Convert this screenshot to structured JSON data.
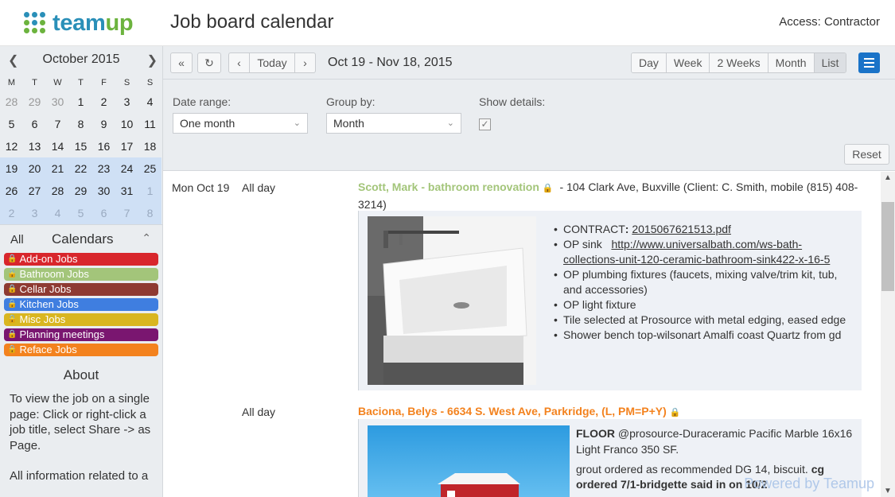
{
  "header": {
    "logo_text": "team",
    "logo_text_accent": "up",
    "title": "Job board calendar",
    "access": "Access: Contractor"
  },
  "mini_calendar": {
    "month": "October 2015",
    "prev_icon": "chevron-left-icon",
    "next_icon": "chevron-right-icon",
    "dow": [
      "M",
      "T",
      "W",
      "T",
      "F",
      "S",
      "S"
    ],
    "days": [
      {
        "d": "28",
        "other": true,
        "range": false
      },
      {
        "d": "29",
        "other": true,
        "range": false
      },
      {
        "d": "30",
        "other": true,
        "range": false
      },
      {
        "d": "1",
        "other": false,
        "range": false
      },
      {
        "d": "2",
        "other": false,
        "range": false
      },
      {
        "d": "3",
        "other": false,
        "range": false
      },
      {
        "d": "4",
        "other": false,
        "range": false
      },
      {
        "d": "5",
        "other": false,
        "range": false
      },
      {
        "d": "6",
        "other": false,
        "range": false
      },
      {
        "d": "7",
        "other": false,
        "range": false
      },
      {
        "d": "8",
        "other": false,
        "range": false
      },
      {
        "d": "9",
        "other": false,
        "range": false
      },
      {
        "d": "10",
        "other": false,
        "range": false
      },
      {
        "d": "11",
        "other": false,
        "range": false
      },
      {
        "d": "12",
        "other": false,
        "range": false
      },
      {
        "d": "13",
        "other": false,
        "range": false
      },
      {
        "d": "14",
        "other": false,
        "range": false
      },
      {
        "d": "15",
        "other": false,
        "range": false
      },
      {
        "d": "16",
        "other": false,
        "range": false
      },
      {
        "d": "17",
        "other": false,
        "range": false
      },
      {
        "d": "18",
        "other": false,
        "range": false
      },
      {
        "d": "19",
        "other": false,
        "range": true
      },
      {
        "d": "20",
        "other": false,
        "range": true
      },
      {
        "d": "21",
        "other": false,
        "range": true
      },
      {
        "d": "22",
        "other": false,
        "range": true
      },
      {
        "d": "23",
        "other": false,
        "range": true
      },
      {
        "d": "24",
        "other": false,
        "range": true
      },
      {
        "d": "25",
        "other": false,
        "range": true
      },
      {
        "d": "26",
        "other": false,
        "range": true
      },
      {
        "d": "27",
        "other": false,
        "range": true
      },
      {
        "d": "28",
        "other": false,
        "range": true
      },
      {
        "d": "29",
        "other": false,
        "range": true
      },
      {
        "d": "30",
        "other": false,
        "range": true
      },
      {
        "d": "31",
        "other": false,
        "range": true
      },
      {
        "d": "1",
        "other": true,
        "range": true
      },
      {
        "d": "2",
        "other": true,
        "range": true
      },
      {
        "d": "3",
        "other": true,
        "range": true
      },
      {
        "d": "4",
        "other": true,
        "range": true
      },
      {
        "d": "5",
        "other": true,
        "range": true
      },
      {
        "d": "6",
        "other": true,
        "range": true
      },
      {
        "d": "7",
        "other": true,
        "range": true
      },
      {
        "d": "8",
        "other": true,
        "range": true
      }
    ]
  },
  "calendars": {
    "all_label": "All",
    "title": "Calendars",
    "collapse_icon": "chevron-up-icon",
    "items": [
      {
        "label": "Add-on Jobs",
        "color": "#d8262c"
      },
      {
        "label": "Bathroom Jobs",
        "color": "#a3c57a"
      },
      {
        "label": "Cellar Jobs",
        "color": "#8e3a32"
      },
      {
        "label": "Kitchen Jobs",
        "color": "#3f7ee0"
      },
      {
        "label": "Misc Jobs",
        "color": "#d9b620"
      },
      {
        "label": "Planning meetings",
        "color": "#7a1670"
      },
      {
        "label": "Reface Jobs",
        "color": "#f3821e"
      }
    ]
  },
  "about": {
    "title": "About",
    "paragraphs": [
      "To view the job on a single page: Click or right-click a job title, select Share -> as Page.",
      "All information related to a"
    ]
  },
  "toolbar": {
    "back_icon": "double-chevron-left-icon",
    "refresh_icon": "refresh-icon",
    "prev_icon": "chevron-left-icon",
    "today": "Today",
    "next_icon": "chevron-right-icon",
    "range": "Oct 19 - Nov 18, 2015",
    "views": [
      "Day",
      "Week",
      "2 Weeks",
      "Month",
      "List"
    ],
    "active_view": "List",
    "menu_icon": "hamburger-menu-icon"
  },
  "filters": {
    "date_range_label": "Date range:",
    "date_range_value": "One month",
    "group_by_label": "Group by:",
    "group_by_value": "Month",
    "show_details_label": "Show details:",
    "show_details_checked": true,
    "reset": "Reset"
  },
  "events": [
    {
      "date": "Mon Oct 19",
      "time": "All day",
      "title": "Scott, Mark - bathroom renovation",
      "title_color": "#a3c57a",
      "rest": " - 104 Clark Ave, Buxville (Client: C. Smith, mobile (815) 408-3214)",
      "lock_icon": "lock-icon",
      "photo_icon": "sink-photo",
      "bullets": [
        {
          "prefix": "CONTRACT",
          "bold_colon": ":",
          "link": "2015067621513.pdf"
        },
        {
          "prefix": "OP sink",
          "link": "http://www.universalbath.com/ws-bath-collections-unit-120-ceramic-bathroom-sink422-x-16-5"
        },
        {
          "text": "OP plumbing fixtures (faucets, mixing valve/trim kit, tub, and accessories)"
        },
        {
          "text": "OP light fixture"
        },
        {
          "text": "Tile selected at Prosource with metal edging, eased edge"
        },
        {
          "text": "Shower bench top-wilsonart Amalfi coast Quartz from gd"
        }
      ]
    },
    {
      "date": "",
      "time": "All day",
      "title": "Baciona, Belys - 6634 S. West Ave, Parkridge, (L, PM=P+Y)",
      "title_color": "#f3821e",
      "lock_icon": "lock-icon",
      "photo_icon": "barn-photo",
      "detail_bold": "FLOOR",
      "detail_line1": " @prosource-Duraceramic Pacific Marble 16x16 Light Franco 350 SF.",
      "detail_line2": "grout ordered as recommended DG 14, biscuit. ",
      "detail_line2_bold": "cg ordered 7/1-bridgette said in on 10/2"
    }
  ],
  "watermark": "Powered by Teamup"
}
